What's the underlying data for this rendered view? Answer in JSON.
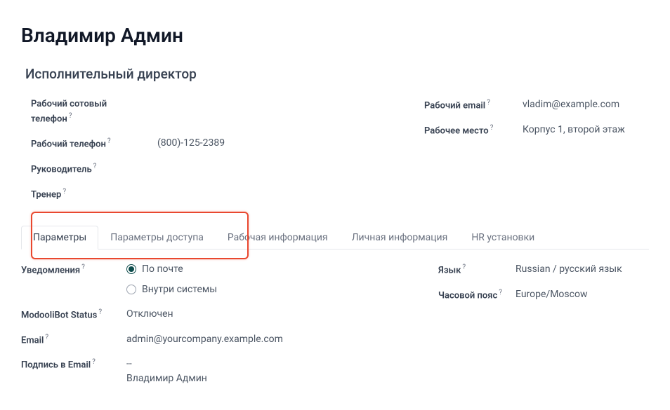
{
  "title": "Владимир Админ",
  "jobTitle": "Исполнительный директор",
  "contactLeft": {
    "mobileLabel": "Рабочий сотовый\nтелефон",
    "mobileValue": "",
    "phoneLabel": "Рабочий телефон",
    "phoneValue": "(800)-125-2389",
    "managerLabel": "Руководитель",
    "managerValue": "",
    "coachLabel": "Тренер",
    "coachValue": ""
  },
  "contactRight": {
    "emailLabel": "Рабочий email",
    "emailValue": "vladim@example.com",
    "workplaceLabel": "Рабочее место",
    "workplaceValue": "Корпус 1, второй этаж"
  },
  "tabs": [
    {
      "label": "Параметры",
      "active": true
    },
    {
      "label": "Параметры доступа",
      "active": false
    },
    {
      "label": "Рабочая информация",
      "active": false
    },
    {
      "label": "Личная информация",
      "active": false
    },
    {
      "label": "HR установки",
      "active": false
    }
  ],
  "settingsLeft": {
    "notifLabel": "Уведомления",
    "notifOptions": {
      "byMail": "По почте",
      "internal": "Внутри системы"
    },
    "botStatusLabel": "ModooliBot Status",
    "botStatusValue": "Отключен",
    "emailLabel": "Email",
    "emailValue": "admin@yourcompany.example.com",
    "signatureLabel": "Подпись в Email",
    "signatureValue": "--\nВладимир Админ"
  },
  "settingsRight": {
    "langLabel": "Язык",
    "langValue": "Russian / русский язык",
    "tzLabel": "Часовой пояс",
    "tzValue": "Europe/Moscow"
  },
  "helpGlyph": "?"
}
